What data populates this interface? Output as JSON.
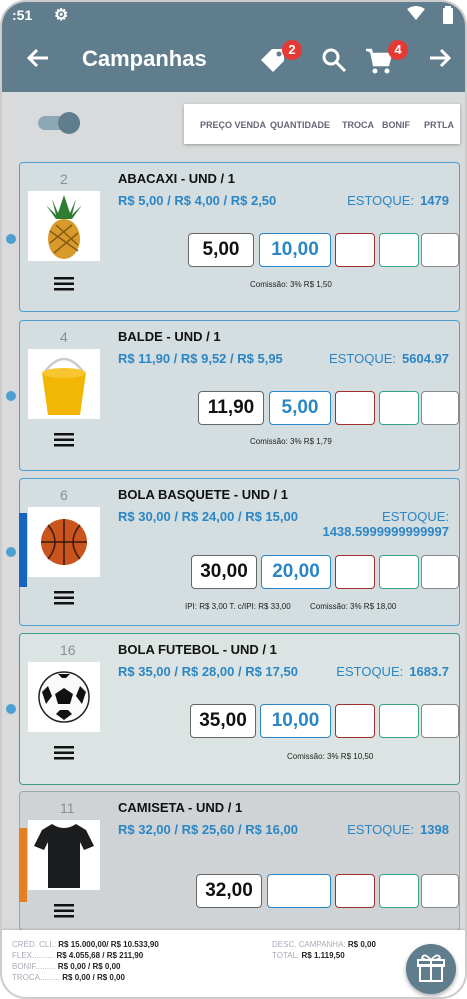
{
  "status": {
    "time": ":51"
  },
  "appbar": {
    "title": "Campanhas",
    "tag_badge": "2",
    "cart_badge": "4"
  },
  "filters": [
    "PREÇO VENDA",
    "QUANTIDADE",
    "TROCA",
    "BONIF",
    "PRTLA"
  ],
  "products": [
    {
      "code": "2",
      "name": "ABACAXI - UND / 1",
      "prices": "R$ 5,00 / R$ 4,00 / R$ 2,50",
      "stock_label": "ESTOQUE:",
      "stock": "1479",
      "price": "5,00",
      "qty": "10,00",
      "commission_label": "Comissão: 3% R$ 1,50",
      "ipi_label": "",
      "image": "pineapple",
      "side_color": ""
    },
    {
      "code": "4",
      "name": "BALDE - UND / 1",
      "prices": "R$ 11,90 / R$ 9,52 / R$ 5,95",
      "stock_label": "ESTOQUE:",
      "stock": "5604.97",
      "price": "11,90",
      "qty": "5,00",
      "commission_label": "Comissão: 3% R$ 1,79",
      "ipi_label": "",
      "image": "bucket",
      "side_color": ""
    },
    {
      "code": "6",
      "name": "BOLA BASQUETE - UND / 1",
      "prices": "R$ 30,00 / R$ 24,00 / R$ 15,00",
      "stock_label": "ESTOQUE:",
      "stock": "1438.5999999999997",
      "price": "30,00",
      "qty": "20,00",
      "commission_label": "Comissão: 3% R$ 18,00",
      "ipi_label": "IPI: R$ 3,00 T. c/IPI: R$ 33,00",
      "image": "basketball",
      "side_color": "#1565c0"
    },
    {
      "code": "16",
      "name": "BOLA FUTEBOL - UND / 1",
      "prices": "R$ 35,00 / R$ 28,00 / R$ 17,50",
      "stock_label": "ESTOQUE:",
      "stock": "1683.7",
      "price": "35,00",
      "qty": "10,00",
      "commission_label": "Comissão: 3% R$ 10,50",
      "ipi_label": "",
      "image": "soccer",
      "side_color": ""
    },
    {
      "code": "11",
      "name": "CAMISETA - UND / 1",
      "prices": "R$ 32,00 / R$ 25,60 / R$ 16,00",
      "stock_label": "ESTOQUE:",
      "stock": "1398",
      "price": "32,00",
      "qty": "",
      "commission_label": "",
      "ipi_label": "",
      "image": "tshirt",
      "side_color": "#e67e22"
    }
  ],
  "footer": {
    "cred_label": "CRÉD. CLI.:",
    "cred_value": "R$ 15.000,00/ R$ 10.533,90",
    "flex_label": "FLEX..........",
    "flex_value": "R$ 4.055,68 / R$ 211,90",
    "bonif_label": "BONIF.........",
    "bonif_value": "R$ 0,00 / R$ 0,00",
    "troca_label": "TROCA.........",
    "troca_value": "R$ 0,00 / R$ 0,00",
    "desc_label": "DESC. CAMPANHA:",
    "desc_value": "R$ 0,00",
    "total_label": "TOTAL:",
    "total_value": "R$ 1.119,50"
  }
}
